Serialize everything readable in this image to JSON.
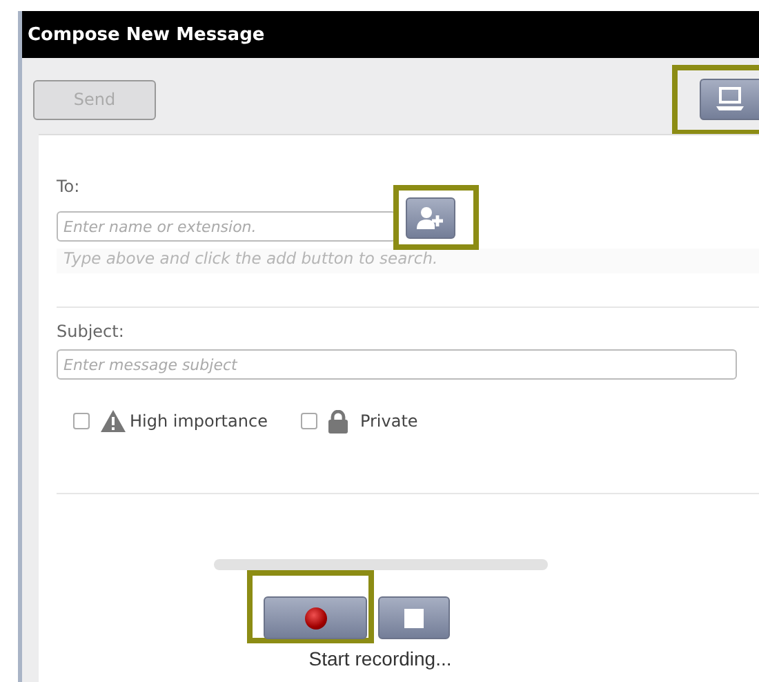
{
  "window": {
    "title": "Compose New Message"
  },
  "toolbar": {
    "send_button": {
      "label": "Send",
      "disabled": true
    },
    "computer_button": {
      "highlighted": true
    }
  },
  "to": {
    "label": "To:",
    "placeholder": "Enter name or extension.",
    "hint": "Type above and click the add button to search.",
    "add_button": {
      "highlighted": true
    }
  },
  "subject": {
    "label": "Subject:",
    "placeholder": "Enter message subject"
  },
  "options": [
    {
      "kind": "warning",
      "label": "High importance",
      "checked": false
    },
    {
      "kind": "lock",
      "label": "Private",
      "checked": false
    }
  ],
  "recorder": {
    "record_button": {
      "highlighted": true
    },
    "status": "Start recording..."
  }
}
